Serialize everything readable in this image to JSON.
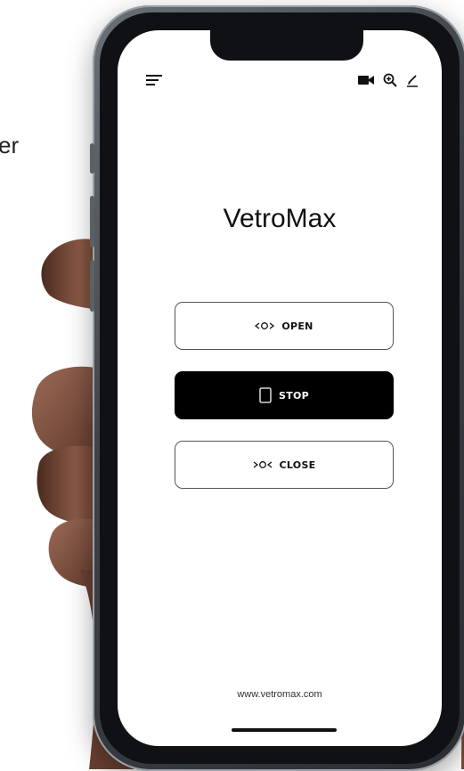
{
  "background": {
    "partial_text": "er"
  },
  "app": {
    "title": "VetroMax"
  },
  "toolbar": {
    "menu_icon": "hamburger-menu-icon",
    "video_icon": "video-camera-icon",
    "search_icon": "zoom-search-icon",
    "edit_icon": "pencil-edit-icon"
  },
  "controls": {
    "open_label": "OPEN",
    "stop_label": "STOP",
    "close_label": "CLOSE"
  },
  "footer": {
    "url": "www.vetromax.com"
  },
  "colors": {
    "primary_dark": "#000000",
    "surface": "#ffffff",
    "border": "#555555"
  }
}
